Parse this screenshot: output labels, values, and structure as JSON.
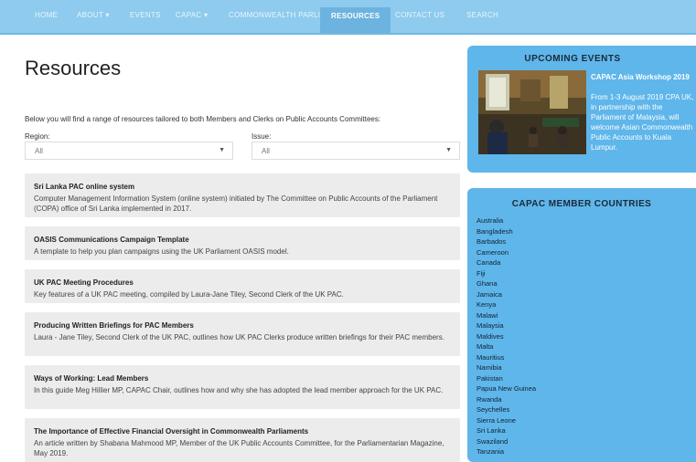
{
  "nav": {
    "items": [
      {
        "label": "HOME"
      },
      {
        "label": "ABOUT ▾"
      },
      {
        "label": "EVENTS"
      },
      {
        "label": "CAPAC ▾"
      },
      {
        "label": "COMMONWEALTH PARLIAMENTS"
      },
      {
        "label": "RESOURCES"
      },
      {
        "label": "CONTACT US"
      },
      {
        "label": "SEARCH"
      }
    ],
    "active": "RESOURCES"
  },
  "main": {
    "title": "Resources",
    "intro": "Below you will find a range of resources tailored to both Members and Clerks on Public Accounts Committees:",
    "filters": {
      "region": {
        "label": "Region:",
        "value": "All"
      },
      "issue": {
        "label": "Issue:",
        "value": "All"
      }
    },
    "resources": [
      {
        "title": "Sri Lanka PAC online system",
        "description": "Computer Management Information System (online system) initiated by The Committee on Public Accounts of the Parliament (COPA) office of Sri Lanka implemented in 2017."
      },
      {
        "title": "OASIS Communications Campaign Template",
        "description": "A template to help you plan campaigns using the UK Parliament OASIS model."
      },
      {
        "title": "UK PAC Meeting Procedures",
        "description": "Key features of a UK PAC meeting, compiled by Laura-Jane Tiley, Second Clerk of the UK PAC."
      },
      {
        "title": "Producing Written Briefings for PAC Members",
        "description": "Laura - Jane Tiley, Second Clerk of the UK PAC, outlines how UK PAC Clerks produce written briefings for their PAC members."
      },
      {
        "title": "Ways of Working: Lead Members",
        "description": "In this guide Meg Hillier MP, CAPAC Chair, outlines how and why she has adopted the lead member approach for the UK PAC."
      },
      {
        "title": "The Importance of Effective Financial Oversight in Commonwealth Parliaments",
        "description": "An article written by Shabana Mahmood MP, Member of the UK Public Accounts Committee, for the Parliamentarian Magazine, May 2019."
      }
    ]
  },
  "sidebar": {
    "events": {
      "title": "UPCOMING EVENTS",
      "event_title": "CAPAC Asia Workshop 2019",
      "event_text": "From 1-3 August 2019 CPA UK, in partnership with the Parliament of Malaysia, will welcome Asian Commonwealth Public Accounts to Kuala Lumpur."
    },
    "countries": {
      "title": "CAPAC MEMBER COUNTRIES",
      "list": [
        "Australia",
        "Bangladesh",
        "Barbados",
        "Cameroon",
        "Canada",
        "Fiji",
        "Ghana",
        "Jamaica",
        "Kenya",
        "Malawi",
        "Malaysia",
        "Maldives",
        "Malta",
        "Mauritius",
        "Namibia",
        "Pakistan",
        "Papua New Guinea",
        "Rwanda",
        "Seychelles",
        "Sierra Leone",
        "Sri Lanka",
        "Swaziland",
        "Tanzania"
      ]
    }
  },
  "colors": {
    "nav": "#8ecbee",
    "nav_active": "#6cb3e0",
    "sidebar": "#5fb6ea",
    "card": "#ececec"
  }
}
